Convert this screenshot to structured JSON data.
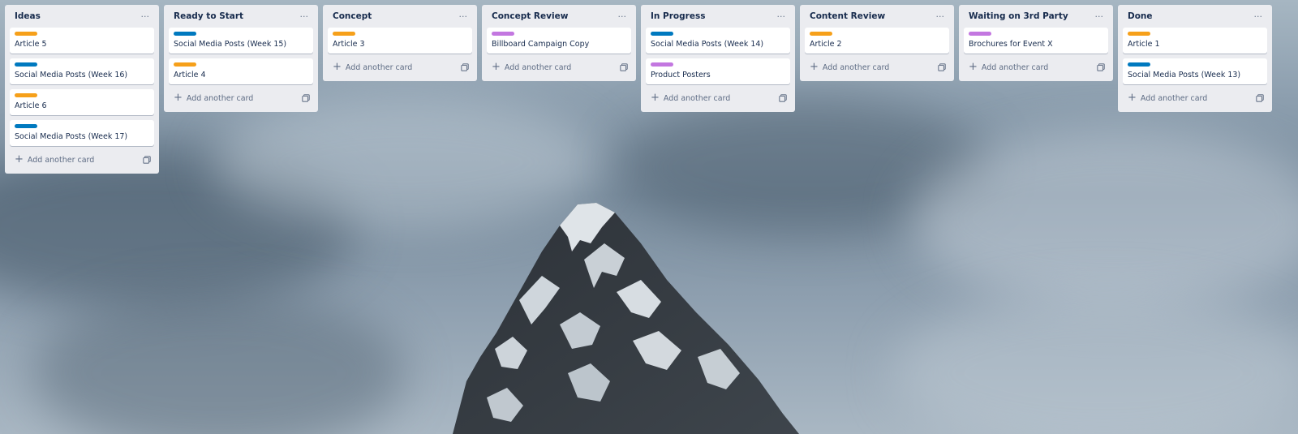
{
  "board": {
    "add_card_label": "Add another card",
    "menu_glyph": "···",
    "label_colors": {
      "orange": "#f6a01a",
      "blue": "#0079bf",
      "purple": "#c377e0"
    },
    "lists": [
      {
        "title": "Ideas",
        "cards": [
          {
            "title": "Article 5",
            "label": "orange"
          },
          {
            "title": "Social Media Posts (Week 16)",
            "label": "blue"
          },
          {
            "title": "Article 6",
            "label": "orange"
          },
          {
            "title": "Social Media Posts (Week 17)",
            "label": "blue"
          }
        ]
      },
      {
        "title": "Ready to Start",
        "cards": [
          {
            "title": "Social Media Posts (Week 15)",
            "label": "blue"
          },
          {
            "title": "Article 4",
            "label": "orange"
          }
        ]
      },
      {
        "title": "Concept",
        "cards": [
          {
            "title": "Article 3",
            "label": "orange"
          }
        ]
      },
      {
        "title": "Concept Review",
        "cards": [
          {
            "title": "Billboard Campaign Copy",
            "label": "purple"
          }
        ]
      },
      {
        "title": "In Progress",
        "cards": [
          {
            "title": "Social Media Posts (Week 14)",
            "label": "blue"
          },
          {
            "title": "Product Posters",
            "label": "purple"
          }
        ]
      },
      {
        "title": "Content Review",
        "cards": [
          {
            "title": "Article 2",
            "label": "orange"
          }
        ]
      },
      {
        "title": "Waiting on 3rd Party",
        "cards": [
          {
            "title": "Brochures for Event X",
            "label": "purple"
          }
        ]
      },
      {
        "title": "Done",
        "cards": [
          {
            "title": "Article 1",
            "label": "orange"
          },
          {
            "title": "Social Media Posts (Week 13)",
            "label": "blue"
          }
        ]
      }
    ]
  }
}
